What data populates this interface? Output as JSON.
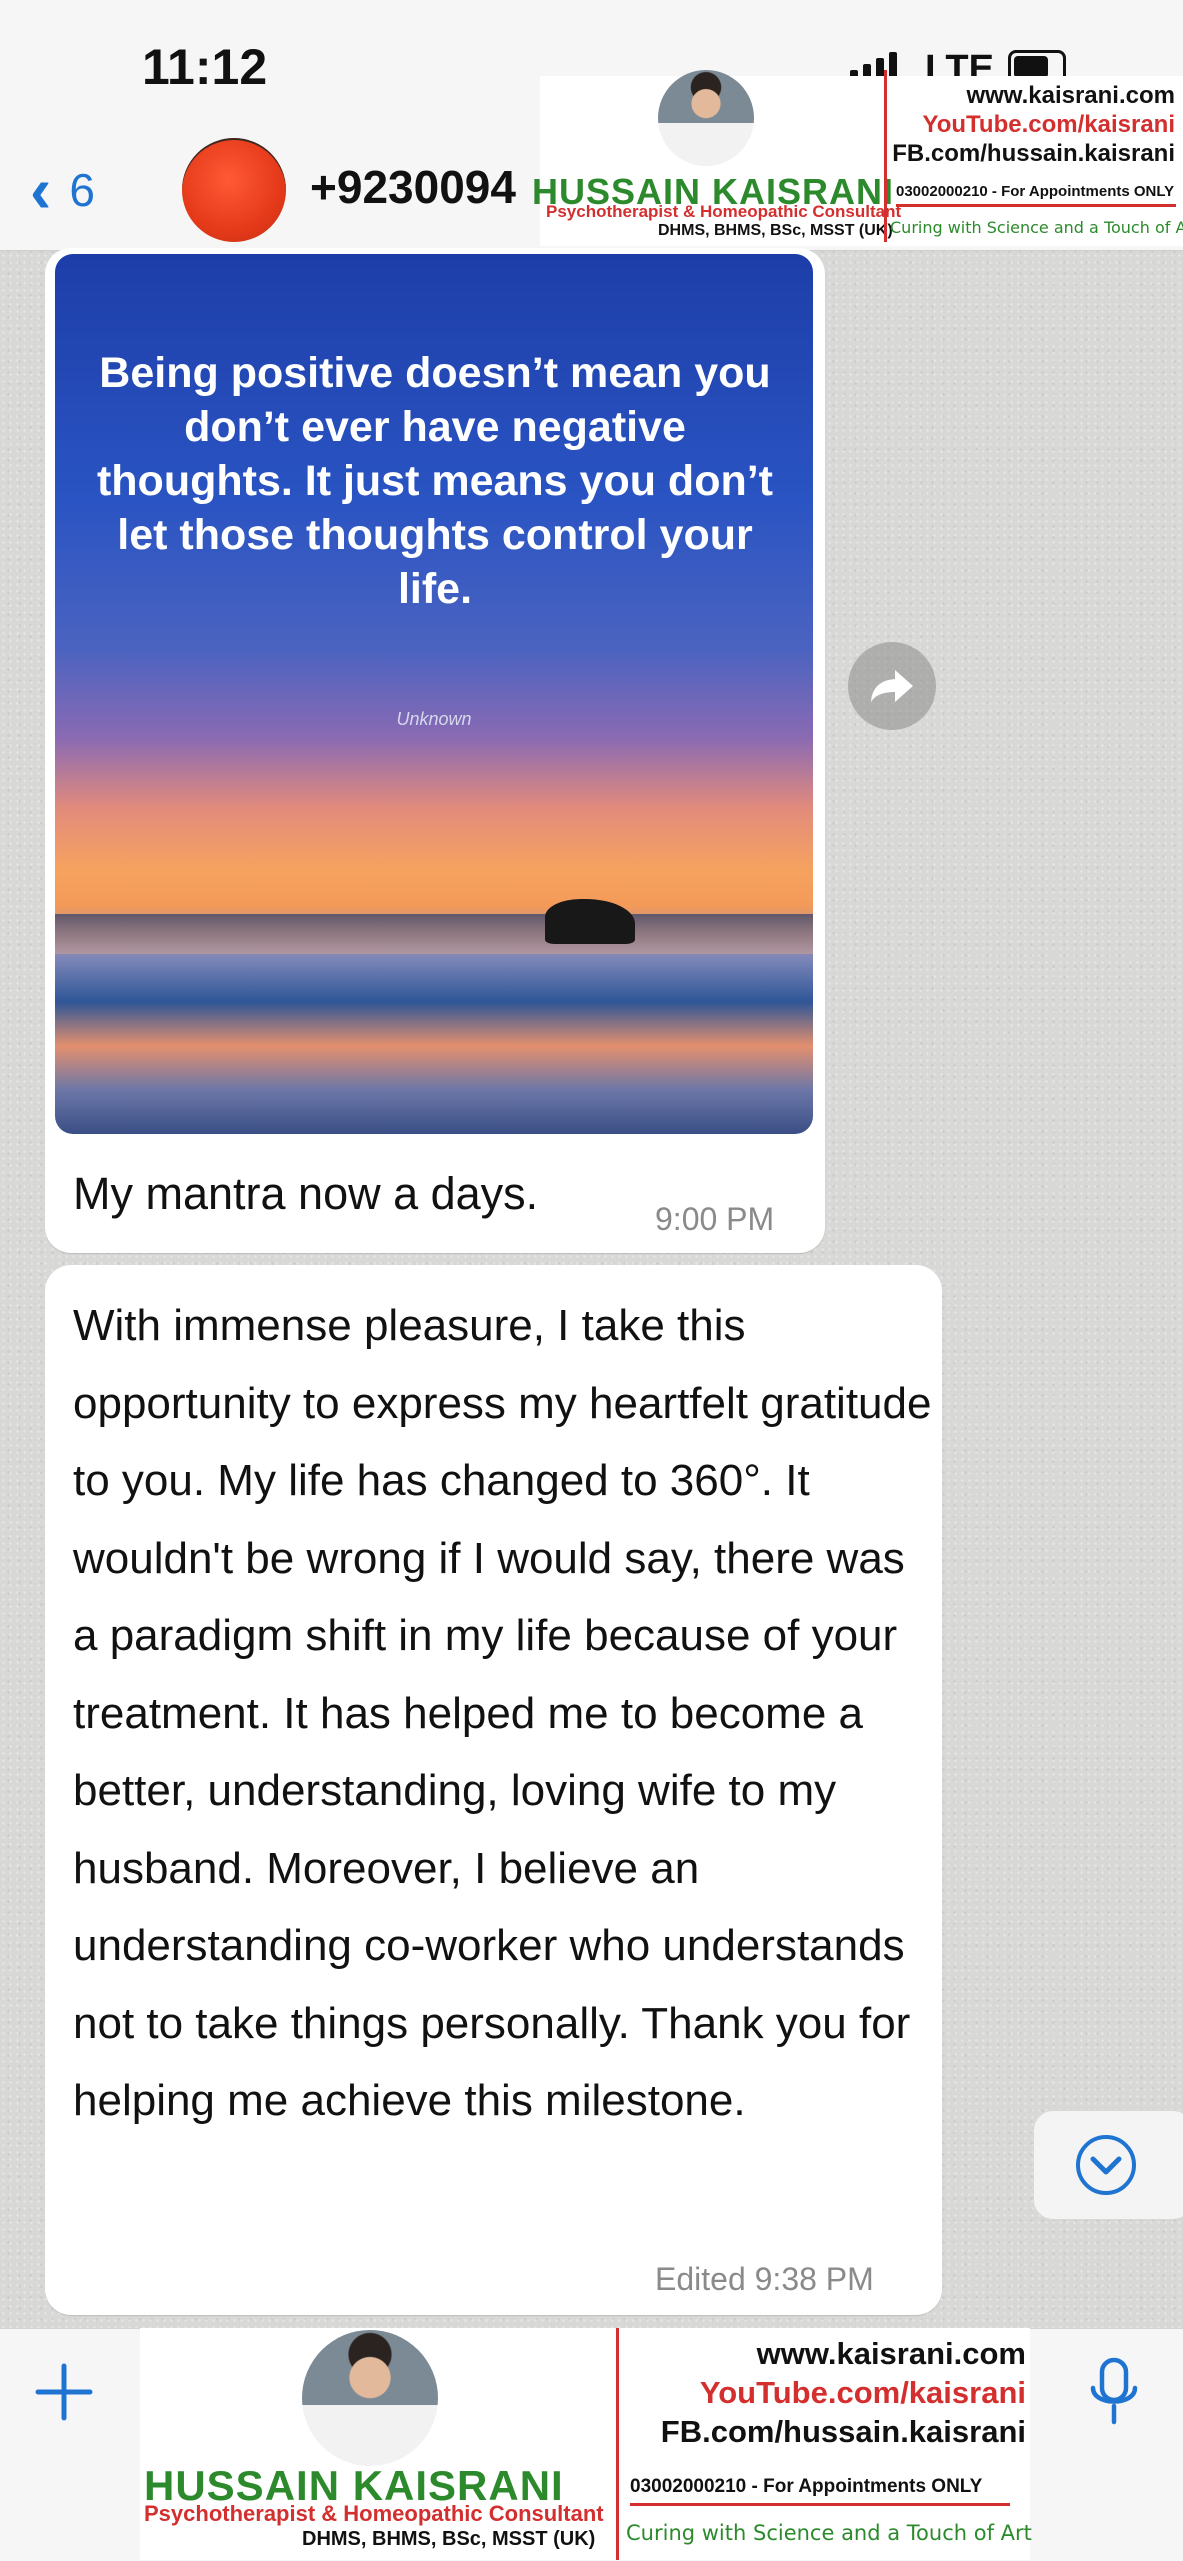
{
  "status_bar": {
    "time": "11:12",
    "network": "LTE"
  },
  "header": {
    "back_count": "6",
    "contact_name": "+9230094"
  },
  "brand": {
    "name": "HUSSAIN KAISRANI",
    "title": "Psychotherapist & Homeopathic Consultant",
    "degrees": "DHMS, BHMS, BSc, MSST (UK)",
    "website": "www.kaisrani.com",
    "youtube": "YouTube.com/kaisrani",
    "facebook": "FB.com/hussain.kaisrani",
    "appointments": "03002000210 - For Appointments ONLY",
    "tagline": "Curing with Science and a Touch of Art",
    "colors": {
      "green": "#2c8a2c",
      "red": "#d32f2f"
    }
  },
  "messages": [
    {
      "type": "image",
      "quote": "Being positive doesn’t mean you don’t ever have negative thoughts. It just means you don’t let those thoughts control your life.",
      "quote_author": "Unknown",
      "caption": "My mantra now a days.",
      "time": "9:00 PM"
    },
    {
      "type": "text",
      "text": "With immense pleasure, I take this opportunity to express my heartfelt gratitude to you. My life has changed to 360°. It wouldn't be wrong if I would say, there was a paradigm shift in my life because of your treatment. It has helped me to become a better, understanding, loving wife to my husband. Moreover, I believe an understanding co-worker who understands not to take things personally.  Thank you for helping me achieve this milestone.",
      "edited_label": "Edited",
      "time": "9:38 PM"
    }
  ],
  "icons": {
    "back": "chevron-left-icon",
    "forward": "forward-arrow-icon",
    "scroll": "chevron-down-icon",
    "plus": "plus-icon",
    "mic": "microphone-icon"
  }
}
